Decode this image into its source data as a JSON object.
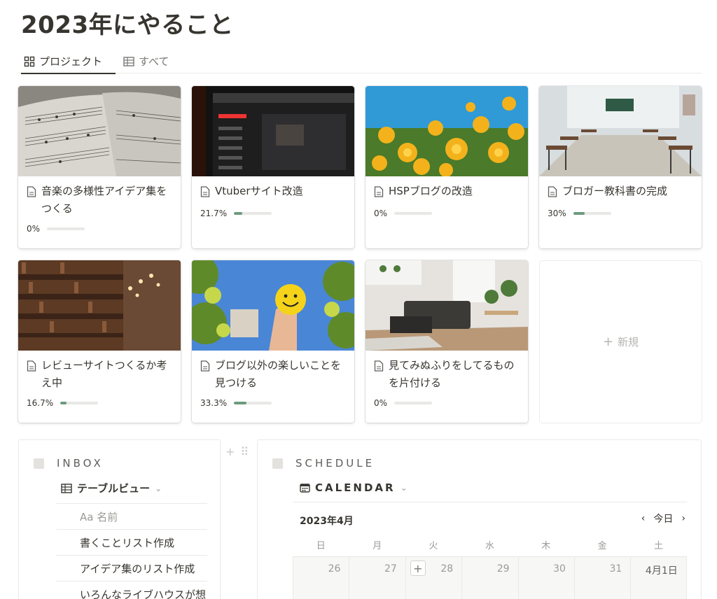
{
  "page": {
    "title": "2023年にやること"
  },
  "tabs": [
    {
      "label": "プロジェクト",
      "icon": "gallery-grid-icon",
      "active": true
    },
    {
      "label": "すべて",
      "icon": "table-icon",
      "active": false
    }
  ],
  "cards": [
    {
      "title": "音楽の多様性アイデア集をつくる",
      "progress_label": "0%",
      "progress": 0.0,
      "cover": "sheet-music-photo"
    },
    {
      "title": "Vtuberサイト改造",
      "progress_label": "21.7%",
      "progress": 0.217,
      "cover": "youtube-screen-photo"
    },
    {
      "title": "HSPブログの改造",
      "progress_label": "0%",
      "progress": 0.0,
      "cover": "yellow-flowers-photo"
    },
    {
      "title": "ブロガー教科書の完成",
      "progress_label": "30%",
      "progress": 0.3,
      "cover": "classroom-photo"
    },
    {
      "title": "レビューサイトつくるか考え中",
      "progress_label": "16.7%",
      "progress": 0.167,
      "cover": "library-bookshelves-photo"
    },
    {
      "title": "ブログ以外の楽しいことを見つける",
      "progress_label": "33.3%",
      "progress": 0.333,
      "cover": "smiley-ball-photo"
    },
    {
      "title": "見てみぬふりをしてるものを片付ける",
      "progress_label": "0%",
      "progress": 0.0,
      "cover": "living-room-photo"
    }
  ],
  "new_card": {
    "label": "新規",
    "icon": "plus-icon"
  },
  "inbox": {
    "heading": "INBOX",
    "view_label": "テーブルビュー",
    "column_header": "Aa 名前",
    "rows": [
      "書くことリスト作成",
      "アイデア集のリスト作成",
      "いろんなライブハウスが想"
    ]
  },
  "schedule": {
    "heading": "SCHEDULE",
    "view_label": "CALENDAR",
    "month": "2023年4月",
    "today_label": "今日",
    "weekdays": [
      "日",
      "月",
      "火",
      "水",
      "木",
      "金",
      "土"
    ],
    "days": [
      "26",
      "27",
      "28",
      "29",
      "30",
      "31",
      "4月1日"
    ]
  },
  "colors": {
    "progress_fill": "#6c9b7d",
    "text": "#37352f",
    "muted": "#9b9a97"
  }
}
